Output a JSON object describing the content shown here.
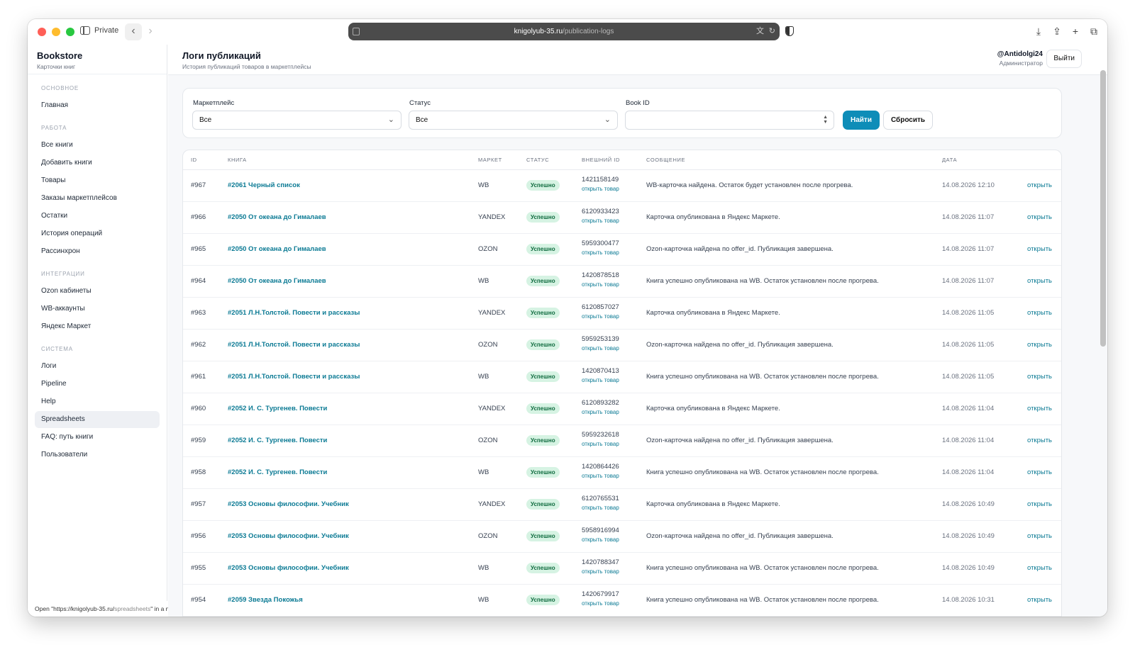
{
  "browser": {
    "private_label": "Private",
    "url_host": "knigolyub-35.ru",
    "url_path": "/publication-logs"
  },
  "sidebar": {
    "brand_title": "Bookstore",
    "brand_subtitle": "Карточки книг",
    "sections": [
      {
        "title": "ОСНОВНОЕ",
        "items": [
          {
            "label": "Главная"
          }
        ]
      },
      {
        "title": "РАБОТА",
        "items": [
          {
            "label": "Все книги"
          },
          {
            "label": "Добавить книги"
          },
          {
            "label": "Товары"
          },
          {
            "label": "Заказы маркетплейсов"
          },
          {
            "label": "Остатки"
          },
          {
            "label": "История операций"
          },
          {
            "label": "Рассинхрон"
          }
        ]
      },
      {
        "title": "ИНТЕГРАЦИИ",
        "items": [
          {
            "label": "Ozon кабинеты"
          },
          {
            "label": "WB-аккаунты"
          },
          {
            "label": "Яндекс Маркет"
          }
        ]
      },
      {
        "title": "СИСТЕМА",
        "items": [
          {
            "label": "Логи"
          },
          {
            "label": "Pipeline"
          },
          {
            "label": "Help"
          },
          {
            "label": "Spreadsheets",
            "active": true
          },
          {
            "label": "FAQ: путь книги"
          },
          {
            "label": "Пользователи"
          }
        ]
      }
    ]
  },
  "status_bar": {
    "prefix": "Open \"https://knigolyub-35.ru/",
    "path": "spreadsheets",
    "suffix": "\" in a new tab"
  },
  "header": {
    "title": "Логи публикаций",
    "subtitle": "История публикаций товаров в маркетплейсы",
    "user_name": "@Antidolgi24",
    "user_role": "Администратор",
    "logout_label": "Выйти"
  },
  "filters": {
    "marketplace_label": "Маркетплейс",
    "marketplace_value": "Все",
    "status_label": "Статус",
    "status_value": "Все",
    "book_id_label": "Book ID",
    "book_id_value": "",
    "find_label": "Найти",
    "reset_label": "Сбросить"
  },
  "table": {
    "columns": [
      "ID",
      "КНИГА",
      "МАРКЕТ",
      "СТАТУС",
      "ВНЕШНИЙ ID",
      "СООБЩЕНИЕ",
      "ДАТА"
    ],
    "open_product_label": "открыть товар",
    "open_label": "открыть",
    "rows": [
      {
        "id": "#967",
        "book": "#2061 Черный список",
        "market": "WB",
        "status": "Успешно",
        "external_id": "1421158149",
        "message": "WB-карточка найдена. Остаток будет установлен после прогрева.",
        "date": "14.08.2026 12:10"
      },
      {
        "id": "#966",
        "book": "#2050 От океана до Гималаев",
        "market": "YANDEX",
        "status": "Успешно",
        "external_id": "6120933423",
        "message": "Карточка опубликована в Яндекс Маркете.",
        "date": "14.08.2026 11:07"
      },
      {
        "id": "#965",
        "book": "#2050 От океана до Гималаев",
        "market": "OZON",
        "status": "Успешно",
        "external_id": "5959300477",
        "message": "Ozon-карточка найдена по offer_id. Публикация завершена.",
        "date": "14.08.2026 11:07"
      },
      {
        "id": "#964",
        "book": "#2050 От океана до Гималаев",
        "market": "WB",
        "status": "Успешно",
        "external_id": "1420878518",
        "message": "Книга успешно опубликована на WB. Остаток установлен после прогрева.",
        "date": "14.08.2026 11:07"
      },
      {
        "id": "#963",
        "book": "#2051 Л.Н.Толстой. Повести и рассказы",
        "market": "YANDEX",
        "status": "Успешно",
        "external_id": "6120857027",
        "message": "Карточка опубликована в Яндекс Маркете.",
        "date": "14.08.2026 11:05"
      },
      {
        "id": "#962",
        "book": "#2051 Л.Н.Толстой. Повести и рассказы",
        "market": "OZON",
        "status": "Успешно",
        "external_id": "5959253139",
        "message": "Ozon-карточка найдена по offer_id. Публикация завершена.",
        "date": "14.08.2026 11:05"
      },
      {
        "id": "#961",
        "book": "#2051 Л.Н.Толстой. Повести и рассказы",
        "market": "WB",
        "status": "Успешно",
        "external_id": "1420870413",
        "message": "Книга успешно опубликована на WB. Остаток установлен после прогрева.",
        "date": "14.08.2026 11:05"
      },
      {
        "id": "#960",
        "book": "#2052 И. С. Тургенев. Повести",
        "market": "YANDEX",
        "status": "Успешно",
        "external_id": "6120893282",
        "message": "Карточка опубликована в Яндекс Маркете.",
        "date": "14.08.2026 11:04"
      },
      {
        "id": "#959",
        "book": "#2052 И. С. Тургенев. Повести",
        "market": "OZON",
        "status": "Успешно",
        "external_id": "5959232618",
        "message": "Ozon-карточка найдена по offer_id. Публикация завершена.",
        "date": "14.08.2026 11:04"
      },
      {
        "id": "#958",
        "book": "#2052 И. С. Тургенев. Повести",
        "market": "WB",
        "status": "Успешно",
        "external_id": "1420864426",
        "message": "Книга успешно опубликована на WB. Остаток установлен после прогрева.",
        "date": "14.08.2026 11:04"
      },
      {
        "id": "#957",
        "book": "#2053 Основы философии. Учебник",
        "market": "YANDEX",
        "status": "Успешно",
        "external_id": "6120765531",
        "message": "Карточка опубликована в Яндекс Маркете.",
        "date": "14.08.2026 10:49"
      },
      {
        "id": "#956",
        "book": "#2053 Основы философии. Учебник",
        "market": "OZON",
        "status": "Успешно",
        "external_id": "5958916994",
        "message": "Ozon-карточка найдена по offer_id. Публикация завершена.",
        "date": "14.08.2026 10:49"
      },
      {
        "id": "#955",
        "book": "#2053 Основы философии. Учебник",
        "market": "WB",
        "status": "Успешно",
        "external_id": "1420788347",
        "message": "Книга успешно опубликована на WB. Остаток установлен после прогрева.",
        "date": "14.08.2026 10:49"
      },
      {
        "id": "#954",
        "book": "#2059 Звезда Покожья",
        "market": "WB",
        "status": "Успешно",
        "external_id": "1420679917",
        "message": "Книга успешно опубликована на WB. Остаток установлен после прогрева.",
        "date": "14.08.2026 10:31"
      }
    ]
  },
  "colors": {
    "accent": "#0e8db8",
    "link": "#0b7a94",
    "status_success_bg": "#d6f3e3",
    "status_success_text": "#0f6b3f"
  }
}
